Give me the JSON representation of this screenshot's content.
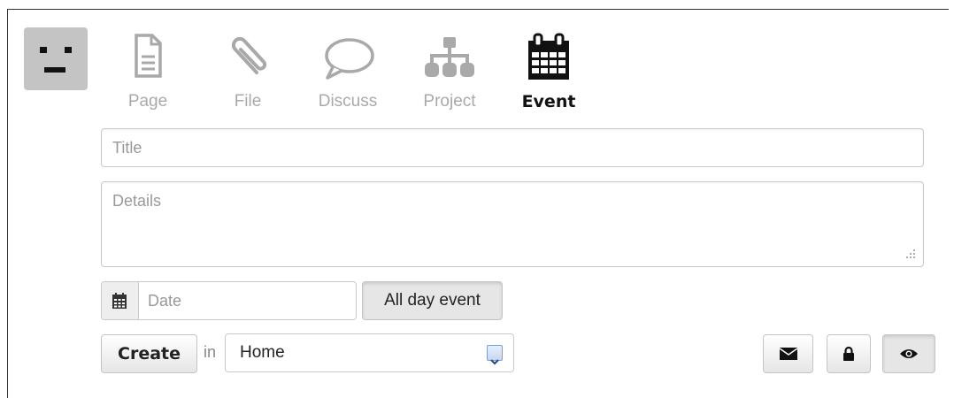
{
  "tabs": [
    {
      "label": "Page",
      "icon": "page-icon",
      "active": false
    },
    {
      "label": "File",
      "icon": "paperclip-icon",
      "active": false
    },
    {
      "label": "Discuss",
      "icon": "speech-bubble-icon",
      "active": false
    },
    {
      "label": "Project",
      "icon": "sitemap-icon",
      "active": false
    },
    {
      "label": "Event",
      "icon": "calendar-icon",
      "active": true
    }
  ],
  "form": {
    "title_placeholder": "Title",
    "details_placeholder": "Details",
    "date_placeholder": "Date",
    "all_day_label": "All day event",
    "create_label": "Create",
    "in_label": "in",
    "location_value": "Home"
  },
  "toolbar": {
    "icons": [
      "envelope-icon",
      "lock-icon",
      "eye-icon"
    ]
  },
  "colors": {
    "inactive_tab": "#a9a9a9",
    "active_tab": "#111111",
    "border": "#c9c9c9"
  }
}
